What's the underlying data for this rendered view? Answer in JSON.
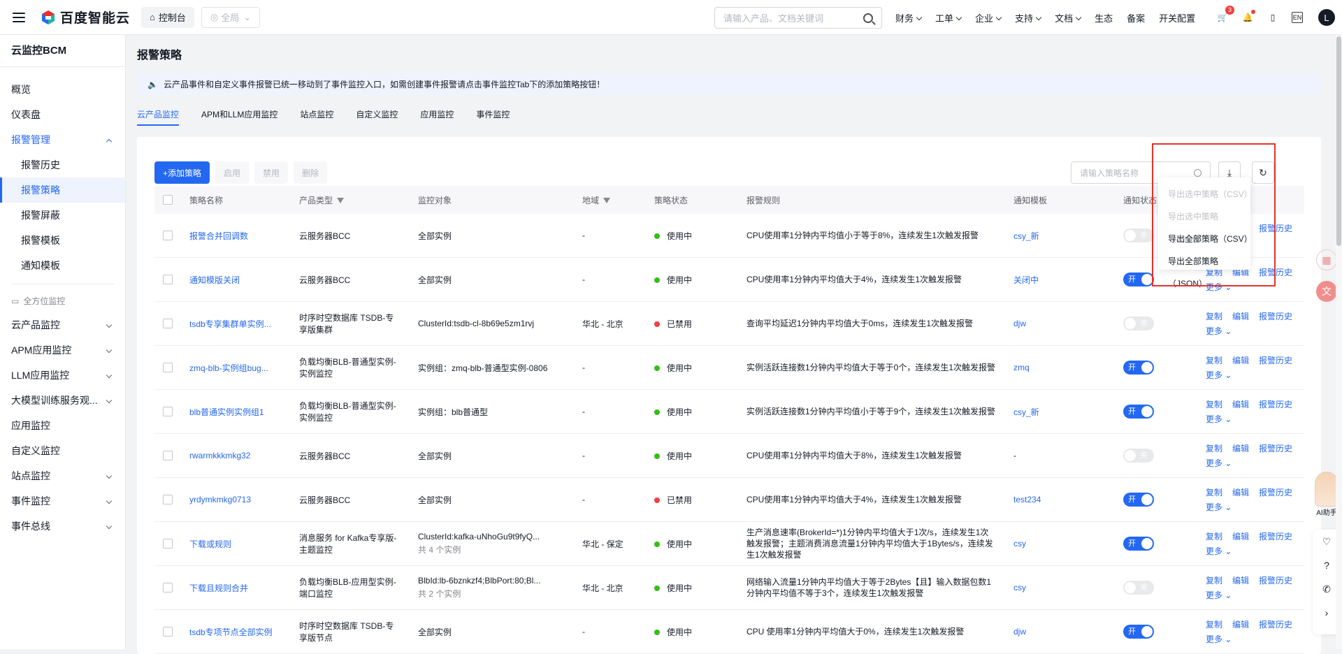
{
  "brand": {
    "name": "百度智能云"
  },
  "top": {
    "console": "控制台",
    "region": "全局",
    "search_placeholder": "请输入产品、文档关键词",
    "nav": [
      "财务",
      "工单",
      "企业",
      "支持",
      "文档",
      "生态",
      "备案",
      "开关配置"
    ],
    "cart_badge": "3",
    "lang": "EN",
    "avatar": "L"
  },
  "sidebar": {
    "title": "云监控BCM",
    "items": [
      {
        "label": "概览"
      },
      {
        "label": "仪表盘"
      },
      {
        "label": "报警管理"
      },
      {
        "label": "报警历史"
      },
      {
        "label": "报警策略"
      },
      {
        "label": "报警屏蔽"
      },
      {
        "label": "报警模板"
      },
      {
        "label": "通知模板"
      }
    ],
    "group": "全方位监控",
    "group_items": [
      "云产品监控",
      "APM应用监控",
      "LLM应用监控",
      "大模型训练服务观...",
      "应用监控",
      "自定义监控",
      "站点监控",
      "事件监控",
      "事件总线"
    ]
  },
  "page": {
    "title": "报警策略",
    "notice": "云产品事件和自定义事件报警已统一移动到了事件监控入口，如需创建事件报警请点击事件监控Tab下的添加策略按钮！",
    "tabs": [
      "云产品监控",
      "APM和LLM应用监控",
      "站点监控",
      "自定义监控",
      "应用监控",
      "事件监控"
    ]
  },
  "toolbar": {
    "add": "+添加策略",
    "enable": "启用",
    "disable": "禁用",
    "delete": "删除",
    "search_placeholder": "请输入策略名称"
  },
  "table": {
    "headers": [
      "策略名称",
      "产品类型",
      "监控对象",
      "地域",
      "策略状态",
      "报警规则",
      "通知模板",
      "通知状态"
    ],
    "rows": [
      {
        "name": "报警合并回调数",
        "product": "云服务器BCC",
        "product2": "",
        "target": "全部实例",
        "target2": "",
        "region": "-",
        "status": "使用中",
        "status_color": "#30bf13",
        "rule": "CPU使用率1分钟内平均值小于等于8%，连续发生1次触发报警",
        "template": "csy_新",
        "notify": false
      },
      {
        "name": "通知模版关闭",
        "product": "云服务器BCC",
        "product2": "",
        "target": "全部实例",
        "target2": "",
        "region": "-",
        "status": "使用中",
        "status_color": "#30bf13",
        "rule": "CPU使用率1分钟内平均值大于4%，连续发生1次触发报警",
        "template": "关闭中",
        "notify": true
      },
      {
        "name": "tsdb专享集群单实例...",
        "product": "时序时空数据库 TSDB-专",
        "product2": "享版集群",
        "target": "ClusterId:tsdb-cl-8b69e5zm1rvj",
        "target2": "",
        "region": "华北 - 北京",
        "status": "已禁用",
        "status_color": "#f33e3e",
        "rule": "查询平均延迟1分钟内平均值大于0ms，连续发生1次触发报警",
        "template": "djw",
        "notify": false
      },
      {
        "name": "zmq-blb-实例组bug...",
        "product": "负载均衡BLB-普通型实例-",
        "product2": "实例监控",
        "target": "实例组：zmq-blb-普通型实例-0806",
        "target2": "",
        "region": "-",
        "status": "使用中",
        "status_color": "#30bf13",
        "rule": "实例活跃连接数1分钟内平均值大于等于0个，连续发生1次触发报警",
        "template": "zmq",
        "notify": true
      },
      {
        "name": "blb普通实例实例组1",
        "product": "负载均衡BLB-普通型实例-",
        "product2": "实例监控",
        "target": "实例组：blb普通型",
        "target2": "",
        "region": "-",
        "status": "使用中",
        "status_color": "#30bf13",
        "rule": "实例活跃连接数1分钟内平均值小于等于9个，连续发生1次触发报警",
        "template": "csy_新",
        "notify": true
      },
      {
        "name": "rwarmkkkmkg32",
        "product": "云服务器BCC",
        "product2": "",
        "target": "全部实例",
        "target2": "",
        "region": "-",
        "status": "使用中",
        "status_color": "#30bf13",
        "rule": "CPU使用率1分钟内平均值大于8%，连续发生1次触发报警",
        "template": "-",
        "notify": false
      },
      {
        "name": "yrdymkmkg0713",
        "product": "云服务器BCC",
        "product2": "",
        "target": "全部实例",
        "target2": "",
        "region": "-",
        "status": "已禁用",
        "status_color": "#f33e3e",
        "rule": "CPU使用率1分钟内平均值大于4%，连续发生1次触发报警",
        "template": "test234",
        "notify": true
      },
      {
        "name": "下载或规则",
        "product": "消息服务 for Kafka专享版-",
        "product2": "主题监控",
        "target": "ClusterId:kafka-uNhoGu9t9fyQ...",
        "target2": "共 4 个实例",
        "region": "华北 - 保定",
        "status": "使用中",
        "status_color": "#30bf13",
        "rule": "生产消息速率(BrokerId=*)1分钟内平均值大于1次/s，连续发生1次触发报警；主题消费消息流量1分钟内平均值大于1Bytes/s，连续发生1次触发报警",
        "template": "csy",
        "notify": true
      },
      {
        "name": "下载且规则合并",
        "product": "负载均衡BLB-应用型实例-",
        "product2": "端口监控",
        "target": "BlbId:lb-6bznkzf4;BlbPort:80;Bl...",
        "target2": "共 2 个实例",
        "region": "华北 - 北京",
        "status": "使用中",
        "status_color": "#30bf13",
        "rule": "网络输入流量1分钟内平均值大于等于2Bytes【且】输入数据包数1分钟内平均值不等于3个，连续发生1次触发报警",
        "template": "csy",
        "notify": false
      },
      {
        "name": "tsdb专项节点全部实例",
        "product": "时序时空数据库 TSDB-专",
        "product2": "享版节点",
        "target": "全部实例",
        "target2": "",
        "region": "-",
        "status": "使用中",
        "status_color": "#30bf13",
        "rule": "CPU 使用率1分钟内平均值大于0%，连续发生1次触发报警",
        "template": "djw",
        "notify": true
      }
    ],
    "ops": {
      "copy": "复制",
      "edit": "编辑",
      "history": "报警历史",
      "more": "更多"
    },
    "switch_on": "开",
    "switch_off": "关"
  },
  "export_menu": [
    "导出选中策略（CSV）",
    "导出选中策略（JSON）",
    "导出全部策略（CSV）",
    "导出全部策略（JSON）"
  ],
  "ai_label": "AI助手"
}
